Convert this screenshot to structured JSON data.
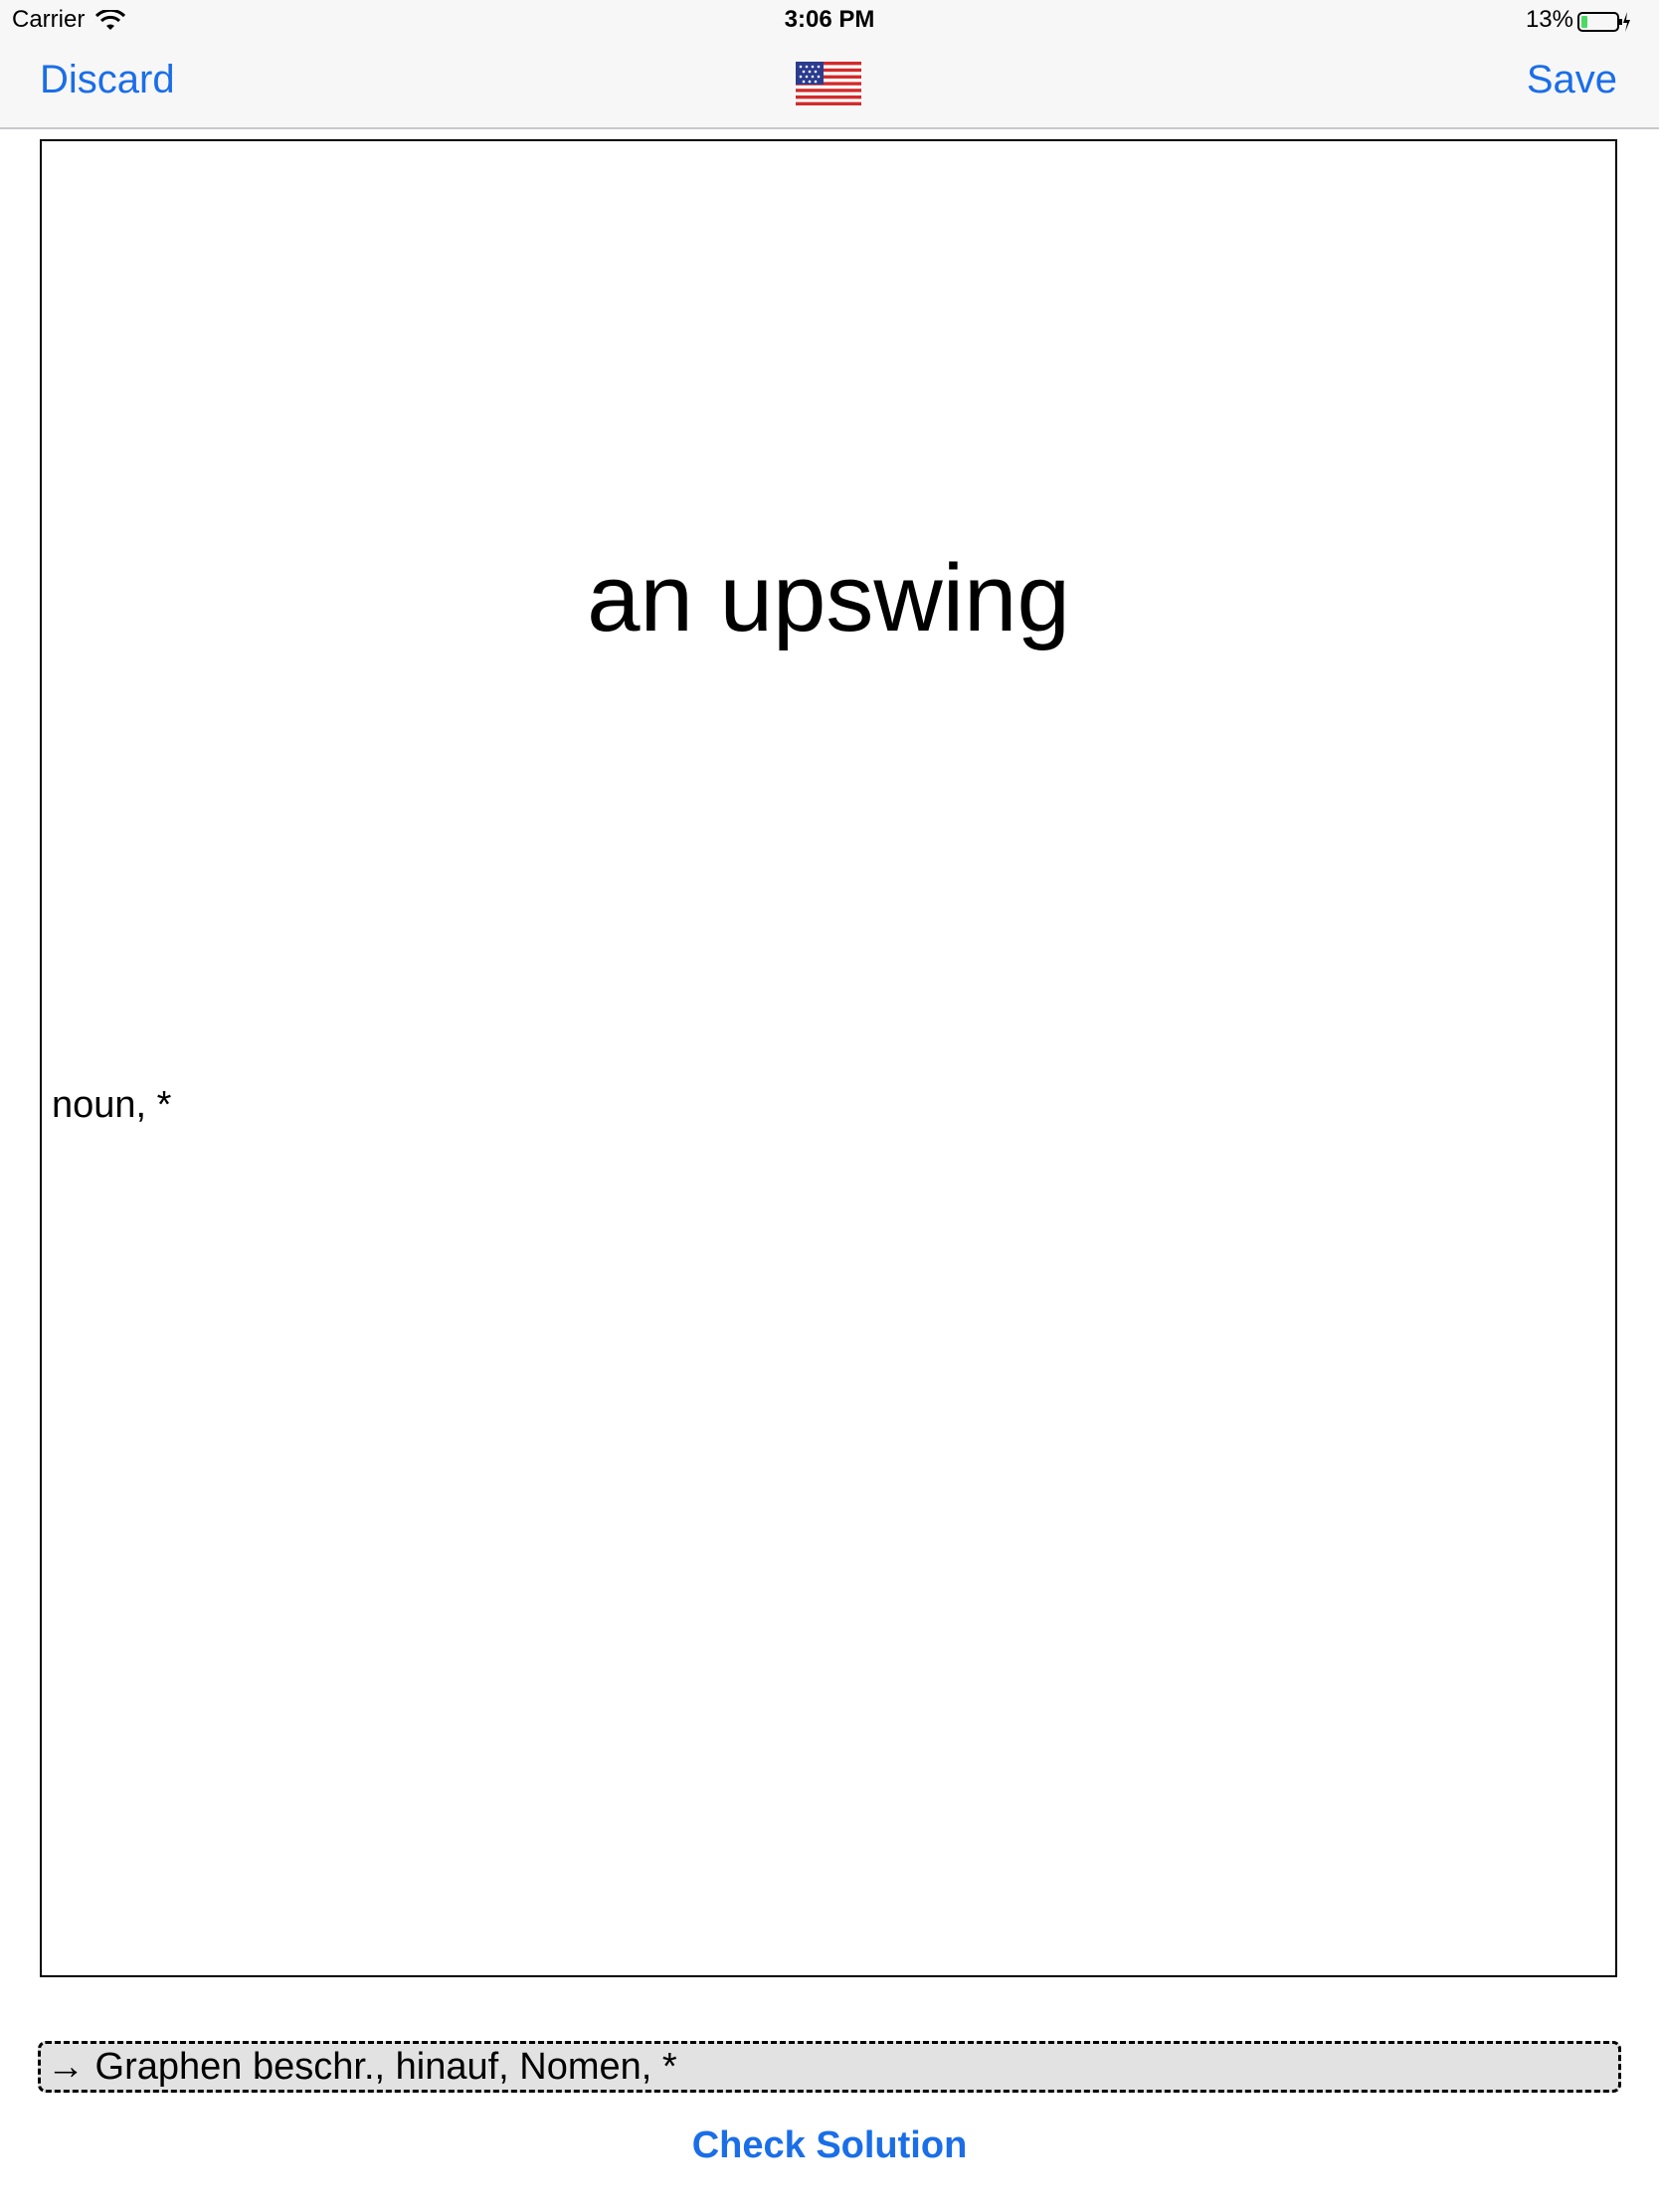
{
  "status_bar": {
    "carrier": "Carrier",
    "time": "3:06 PM",
    "battery_percent": "13%",
    "wifi_icon": "wifi-icon",
    "battery_icon": "battery-charging-icon"
  },
  "nav": {
    "discard_label": "Discard",
    "save_label": "Save",
    "flag_icon": "us-flag-icon"
  },
  "card": {
    "term": "an upswing",
    "part_of_speech": "noun, *"
  },
  "answer": {
    "value": "→ Graphen beschr., hinauf, Nomen, *"
  },
  "check_button_label": "Check Solution",
  "colors": {
    "accent": "#1a6ee8",
    "battery_fill": "#4cd964",
    "answer_background": "#e2e2e2"
  }
}
